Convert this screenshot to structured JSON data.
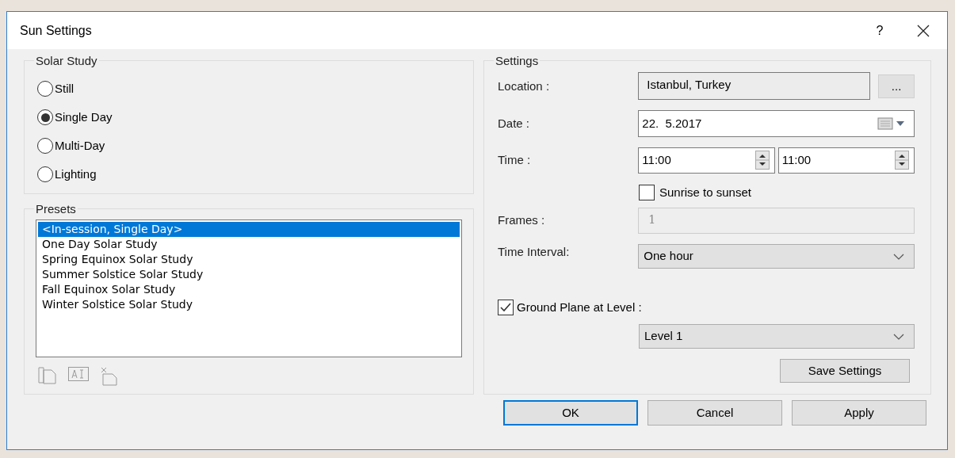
{
  "window": {
    "title": "Sun Settings",
    "help": "?"
  },
  "solar_study": {
    "title": "Solar Study",
    "options": [
      {
        "label": "Still",
        "selected": false
      },
      {
        "label": "Single Day",
        "selected": true
      },
      {
        "label": "Multi-Day",
        "selected": false
      },
      {
        "label": "Lighting",
        "selected": false
      }
    ]
  },
  "presets": {
    "title": "Presets",
    "items": [
      {
        "label": "<In-session, Single Day>",
        "selected": true
      },
      {
        "label": "One Day Solar Study",
        "selected": false
      },
      {
        "label": "Spring Equinox Solar Study",
        "selected": false
      },
      {
        "label": "Summer Solstice Solar Study",
        "selected": false
      },
      {
        "label": "Fall Equinox Solar Study",
        "selected": false
      },
      {
        "label": "Winter Solstice Solar Study",
        "selected": false
      }
    ]
  },
  "settings": {
    "title": "Settings",
    "location": {
      "label": "Location :",
      "value": "Istanbul, Turkey",
      "browse": "..."
    },
    "date": {
      "label": "Date :",
      "value": "22.  5.2017"
    },
    "time": {
      "label": "Time :",
      "start": "11:00",
      "end": "11:00"
    },
    "sunrise_to_sunset": {
      "label": "Sunrise to sunset",
      "checked": false
    },
    "frames": {
      "label": "Frames :",
      "value": "1",
      "disabled": true
    },
    "time_interval": {
      "label": "Time Interval:",
      "value": "One hour"
    },
    "ground_plane": {
      "label": "Ground Plane at Level :",
      "checked": true,
      "value": "Level 1"
    },
    "save_button": "Save Settings"
  },
  "buttons": [
    {
      "label": "OK",
      "focused": true
    },
    {
      "label": "Cancel",
      "focused": false
    },
    {
      "label": "Apply",
      "focused": false
    }
  ]
}
